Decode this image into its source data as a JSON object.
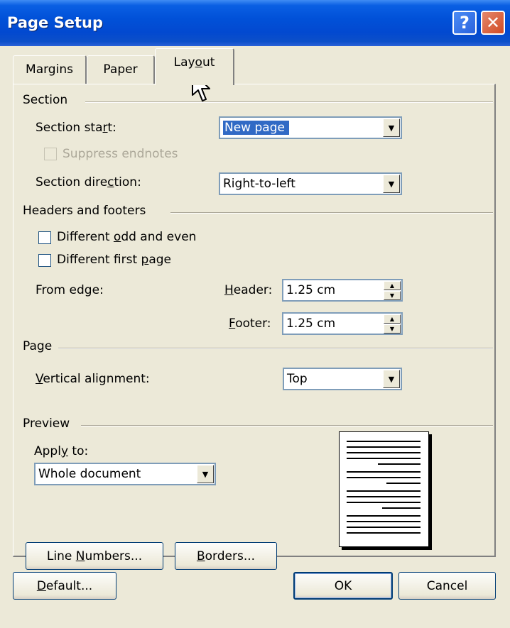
{
  "window": {
    "title": "Page Setup",
    "help_glyph": "?",
    "close_glyph": "✕"
  },
  "tabs": [
    {
      "label": "Margins"
    },
    {
      "label": "Paper"
    },
    {
      "label": "Layout"
    }
  ],
  "section": {
    "group_label": "Section",
    "start_label": "Section start:",
    "start_value": "New page",
    "suppress_endnotes_label": "Suppress endnotes",
    "suppress_endnotes_checked": false,
    "direction_label": "Section direction:",
    "direction_value": "Right-to-left"
  },
  "headers_footers": {
    "group_label": "Headers and footers",
    "odd_even_label": "Different odd and even",
    "odd_even_checked": false,
    "first_page_label": "Different first page",
    "first_page_checked": false,
    "from_edge_label": "From edge:",
    "header_label": "Header:",
    "header_value": "1.25 cm",
    "footer_label": "Footer:",
    "footer_value": "1.25 cm"
  },
  "page": {
    "group_label": "Page",
    "vertical_alignment_label": "Vertical alignment:",
    "vertical_alignment_value": "Top"
  },
  "preview": {
    "group_label": "Preview",
    "apply_to_label": "Apply to:",
    "apply_to_value": "Whole document"
  },
  "buttons": {
    "line_numbers": "Line Numbers...",
    "borders": "Borders...",
    "default": "Default...",
    "ok": "OK",
    "cancel": "Cancel"
  },
  "colors": {
    "title_bar": "#0151d8",
    "dialog_bg": "#ece9d8",
    "selection": "#316ac5",
    "close_button": "#d24a24"
  }
}
